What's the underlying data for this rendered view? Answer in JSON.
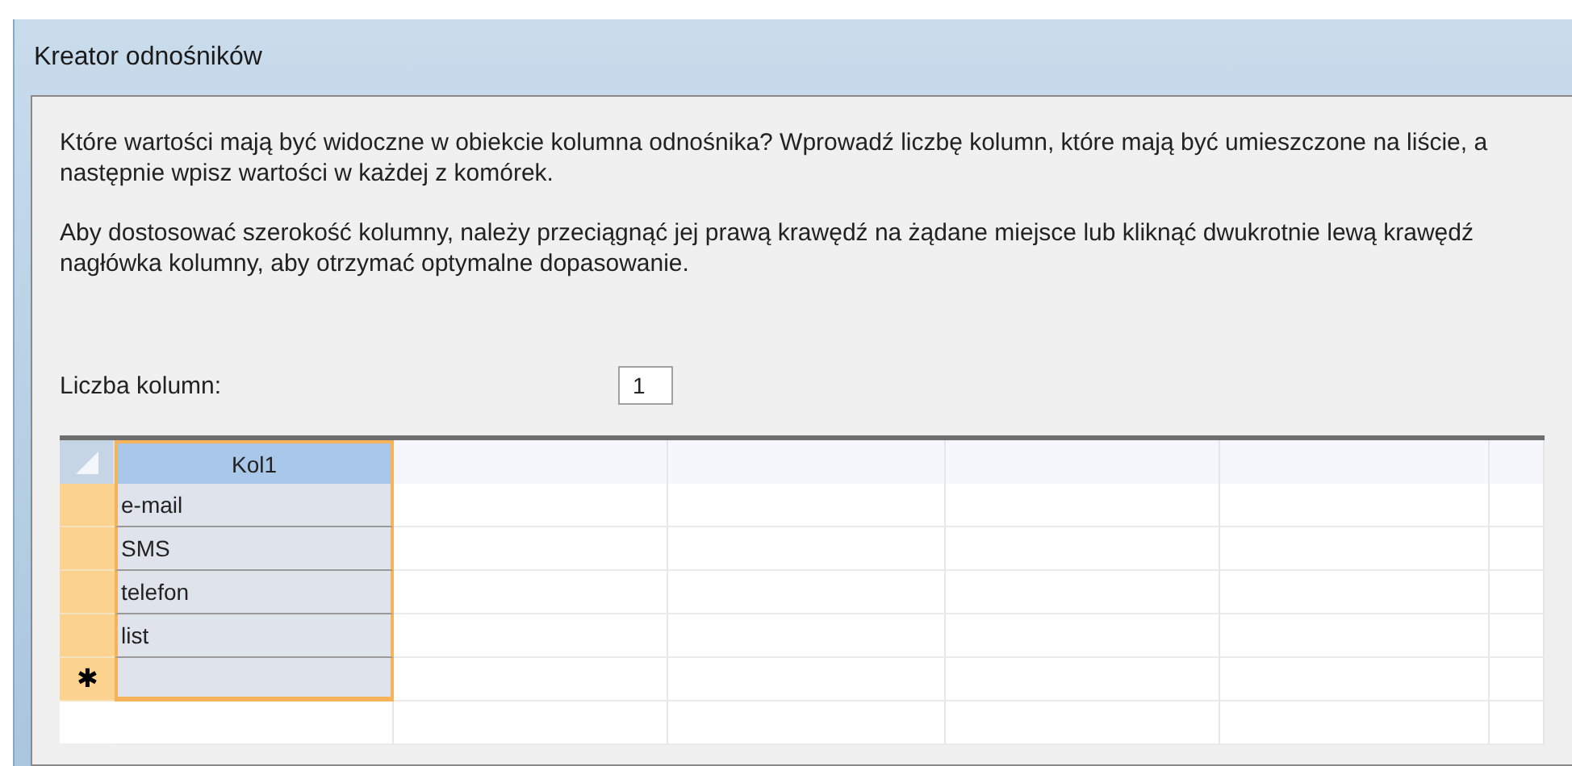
{
  "window": {
    "title": "Kreator odnośników"
  },
  "instructions": [
    "Które wartości mają być widoczne w obiekcie kolumna odnośnika? Wprowadź liczbę kolumn, które mają być umieszczone na liście, a następnie wpisz wartości w każdej z komórek.",
    "Aby dostosować szerokość kolumny, należy przeciągnąć jej prawą krawędź na żądane miejsce lub kliknąć dwukrotnie lewą krawędź nagłówka kolumny, aby otrzymać optymalne dopasowanie."
  ],
  "column_count": {
    "label": "Liczba kolumn:",
    "value": "1"
  },
  "grid": {
    "columns": [
      {
        "label": "Kol1",
        "selected": true
      }
    ],
    "rows": [
      {
        "kind": "value",
        "cells": [
          "e-mail"
        ]
      },
      {
        "kind": "value",
        "cells": [
          "SMS"
        ]
      },
      {
        "kind": "value",
        "cells": [
          "telefon"
        ]
      },
      {
        "kind": "value",
        "cells": [
          "list"
        ]
      },
      {
        "kind": "new",
        "marker": "✱",
        "cells": []
      }
    ]
  }
}
